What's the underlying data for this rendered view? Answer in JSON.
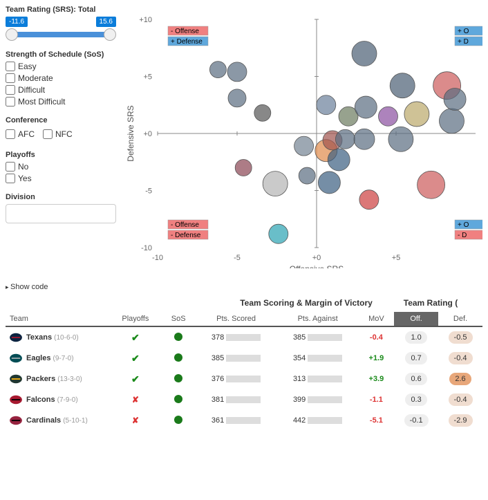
{
  "controls": {
    "srs_label": "Team Rating (SRS): Total",
    "srs_min": "-11.6",
    "srs_max": "15.6",
    "sos_label": "Strength of Schedule (SoS)",
    "sos_options": [
      "Easy",
      "Moderate",
      "Difficult",
      "Most Difficult"
    ],
    "conf_label": "Conference",
    "conf_options": [
      "AFC",
      "NFC"
    ],
    "playoffs_label": "Playoffs",
    "playoffs_options": [
      "No",
      "Yes"
    ],
    "division_label": "Division",
    "show_code": "Show code"
  },
  "chart_data": {
    "type": "scatter",
    "xlabel": "Offensive SRS",
    "ylabel": "Defensive SRS",
    "xlim": [
      -10,
      10
    ],
    "ylim": [
      -10,
      10
    ],
    "xticks": [
      -10,
      -5,
      0,
      5
    ],
    "yticks": [
      -10,
      -5,
      0,
      5,
      10
    ],
    "corners": {
      "top_left": [
        "- Offense",
        "+ Defense"
      ],
      "top_right": [
        "+ O",
        "+ D"
      ],
      "bottom_left": [
        "- Offense",
        "- Defense"
      ],
      "bottom_right": [
        "+ O",
        "- D"
      ]
    },
    "points": [
      {
        "x": -6.2,
        "y": 5.6,
        "r": 12,
        "c": "#5a6c80"
      },
      {
        "x": -5.0,
        "y": 5.4,
        "r": 14,
        "c": "#5a6c80"
      },
      {
        "x": -5.0,
        "y": 3.1,
        "r": 13,
        "c": "#5a6c80"
      },
      {
        "x": -3.4,
        "y": 1.8,
        "r": 12,
        "c": "#555"
      },
      {
        "x": -4.6,
        "y": -3.0,
        "r": 12,
        "c": "#8a4553"
      },
      {
        "x": -2.6,
        "y": -4.4,
        "r": 18,
        "c": "#b4b4b4"
      },
      {
        "x": -2.4,
        "y": -8.8,
        "r": 14,
        "c": "#2aa3b2"
      },
      {
        "x": -0.8,
        "y": -1.1,
        "r": 14,
        "c": "#748393"
      },
      {
        "x": -0.6,
        "y": -3.7,
        "r": 12,
        "c": "#5a6c80"
      },
      {
        "x": 0.6,
        "y": 2.5,
        "r": 14,
        "c": "#6a7f9a"
      },
      {
        "x": 0.6,
        "y": -1.5,
        "r": 16,
        "c": "#e08a4a"
      },
      {
        "x": 0.8,
        "y": -4.3,
        "r": 16,
        "c": "#3a5e80"
      },
      {
        "x": 1.4,
        "y": -2.3,
        "r": 16,
        "c": "#3a5e80"
      },
      {
        "x": 1.0,
        "y": -0.6,
        "r": 14,
        "c": "#a0524d"
      },
      {
        "x": 1.8,
        "y": -0.5,
        "r": 14,
        "c": "#5a6c80"
      },
      {
        "x": 2.0,
        "y": 1.5,
        "r": 14,
        "c": "#6b7a5e"
      },
      {
        "x": 3.0,
        "y": 7.0,
        "r": 18,
        "c": "#4a5e73"
      },
      {
        "x": 3.1,
        "y": 2.3,
        "r": 16,
        "c": "#5a6c80"
      },
      {
        "x": 3.0,
        "y": -0.5,
        "r": 15,
        "c": "#5a6c80"
      },
      {
        "x": 3.3,
        "y": -5.8,
        "r": 14,
        "c": "#cc3f3f"
      },
      {
        "x": 4.5,
        "y": 1.5,
        "r": 14,
        "c": "#8a4fa0"
      },
      {
        "x": 5.4,
        "y": 4.2,
        "r": 18,
        "c": "#4a5e73"
      },
      {
        "x": 5.3,
        "y": -0.5,
        "r": 18,
        "c": "#5a6c80"
      },
      {
        "x": 6.3,
        "y": 1.7,
        "r": 18,
        "c": "#bba86a"
      },
      {
        "x": 7.2,
        "y": -4.5,
        "r": 20,
        "c": "#cc5a5a"
      },
      {
        "x": 8.2,
        "y": 4.2,
        "r": 20,
        "c": "#cc5a5a"
      },
      {
        "x": 8.5,
        "y": 1.1,
        "r": 18,
        "c": "#5a6c80"
      },
      {
        "x": 8.7,
        "y": 3.0,
        "r": 16,
        "c": "#5a6c80"
      }
    ]
  },
  "table": {
    "section_scoring": "Team Scoring & Margin of Victory",
    "section_rating": "Team Rating (",
    "cols": {
      "team": "Team",
      "playoffs": "Playoffs",
      "sos": "SoS",
      "pts_scored": "Pts. Scored",
      "pts_against": "Pts. Against",
      "mov": "MoV",
      "off": "Off.",
      "def": "Def."
    },
    "rows": [
      {
        "team": "Texans",
        "record": "(10-6-0)",
        "playoffs": true,
        "pts_scored": 378,
        "pts_against": 385,
        "mov": -0.4,
        "off": 1.0,
        "def": -0.5,
        "logo_fill": "#0b2340",
        "logo_accent": "#a71930"
      },
      {
        "team": "Eagles",
        "record": "(9-7-0)",
        "playoffs": true,
        "pts_scored": 385,
        "pts_against": 354,
        "mov": 1.9,
        "off": 0.7,
        "def": -0.4,
        "logo_fill": "#004c54",
        "logo_accent": "#a5acaf"
      },
      {
        "team": "Packers",
        "record": "(13-3-0)",
        "playoffs": true,
        "pts_scored": 376,
        "pts_against": 313,
        "mov": 3.9,
        "off": 0.6,
        "def": 2.6,
        "logo_fill": "#203731",
        "logo_accent": "#ffb612"
      },
      {
        "team": "Falcons",
        "record": "(7-9-0)",
        "playoffs": false,
        "pts_scored": 381,
        "pts_against": 399,
        "mov": -1.1,
        "off": 0.3,
        "def": -0.4,
        "logo_fill": "#a71930",
        "logo_accent": "#000"
      },
      {
        "team": "Cardinals",
        "record": "(5-10-1)",
        "playoffs": false,
        "pts_scored": 361,
        "pts_against": 442,
        "mov": -5.1,
        "off": -0.1,
        "def": -2.9,
        "logo_fill": "#97233f",
        "logo_accent": "#000"
      }
    ]
  }
}
